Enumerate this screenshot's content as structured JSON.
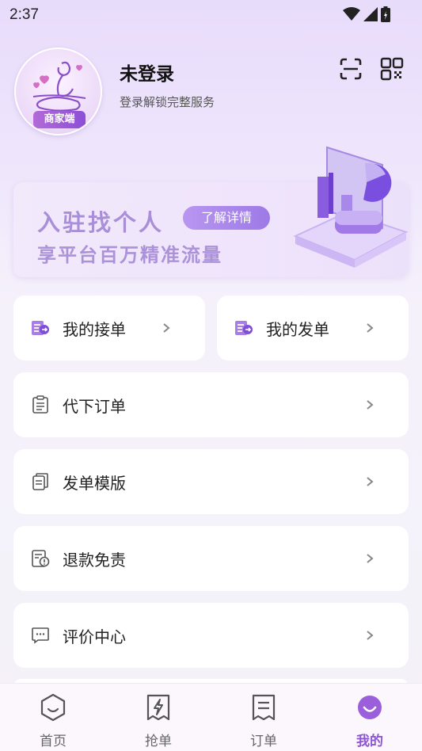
{
  "status_bar": {
    "time": "2:37"
  },
  "profile": {
    "name": "未登录",
    "subtitle": "登录解锁完整服务",
    "avatar_badge": "商家端"
  },
  "banner": {
    "line1": "入驻找个人",
    "line2": "享平台百万精准流量",
    "button": "了解详情"
  },
  "menu": {
    "my_accept": "我的接单",
    "my_publish": "我的发单",
    "items": [
      {
        "label": "代下订单",
        "icon": "clipboard-icon"
      },
      {
        "label": "发单模版",
        "icon": "document-stack-icon"
      },
      {
        "label": "退款免责",
        "icon": "refund-icon"
      },
      {
        "label": "评价中心",
        "icon": "chat-icon"
      }
    ]
  },
  "tabbar": {
    "tabs": [
      {
        "label": "首页",
        "icon": "home-icon"
      },
      {
        "label": "抢单",
        "icon": "bolt-ticket-icon"
      },
      {
        "label": "订单",
        "icon": "order-icon"
      },
      {
        "label": "我的",
        "icon": "profile-icon",
        "active": true
      }
    ]
  },
  "colors": {
    "accent": "#8e55d6",
    "banner_text": "#a98ed8"
  }
}
